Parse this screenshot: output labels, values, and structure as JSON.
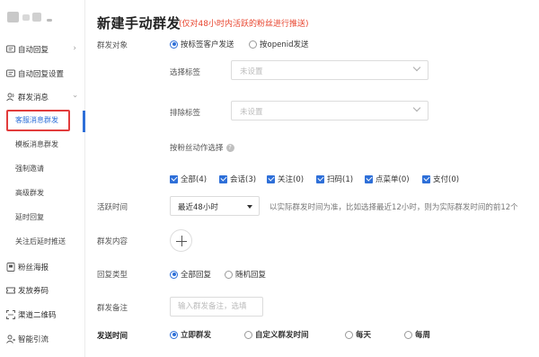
{
  "sidebar": {
    "items": [
      {
        "label": "自动回复",
        "icon": "message-icon"
      },
      {
        "label": "自动回复设置",
        "icon": "message-icon"
      },
      {
        "label": "群发消息",
        "icon": "users-icon"
      },
      {
        "label": "粉丝海报",
        "icon": "poster-icon"
      },
      {
        "label": "发放券码",
        "icon": "ticket-icon"
      },
      {
        "label": "渠道二维码",
        "icon": "qrcode-icon"
      },
      {
        "label": "智能引流",
        "icon": "guide-icon"
      }
    ],
    "sub_items": [
      "客服消息群发",
      "模板消息群发",
      "强制邀请",
      "高级群发",
      "延时回复",
      "关注后延时推送"
    ]
  },
  "main": {
    "title": "新建手动群发",
    "title_note": "(仅对48小时内活跃的粉丝进行推送)",
    "target": {
      "label": "群发对象",
      "options": [
        "按标签客户发送",
        "按openid发送"
      ],
      "selected": "按标签客户发送"
    },
    "select_tags": {
      "label": "选择标签",
      "placeholder": "未设置"
    },
    "exclude_tags": {
      "label": "排除标签",
      "placeholder": "未设置"
    },
    "action_choice": {
      "label": "按粉丝动作选择",
      "help": "?",
      "checks": [
        "全部(4)",
        "会话(3)",
        "关注(0)",
        "扫码(1)",
        "点菜单(0)",
        "支付(0)"
      ]
    },
    "active_time": {
      "label": "活跃时间",
      "value": "最近48小时",
      "hint": "以实际群发时间为准，比如选择最近12小时，则为实际群发时间的前12个"
    },
    "content": {
      "label": "群发内容"
    },
    "reply_type": {
      "label": "回复类型",
      "options": [
        "全部回复",
        "随机回复"
      ],
      "selected": "全部回复"
    },
    "remark": {
      "label": "群发备注",
      "placeholder": "输入群发备注，选填"
    },
    "send_time": {
      "label": "发送时间",
      "options": [
        "立即群发",
        "自定义群发时间",
        "每天",
        "每周"
      ],
      "selected": "立即群发"
    }
  },
  "colors": {
    "accent": "#2e6fd8",
    "warning": "#e8452f",
    "highlight_box": "#e23c3c"
  }
}
